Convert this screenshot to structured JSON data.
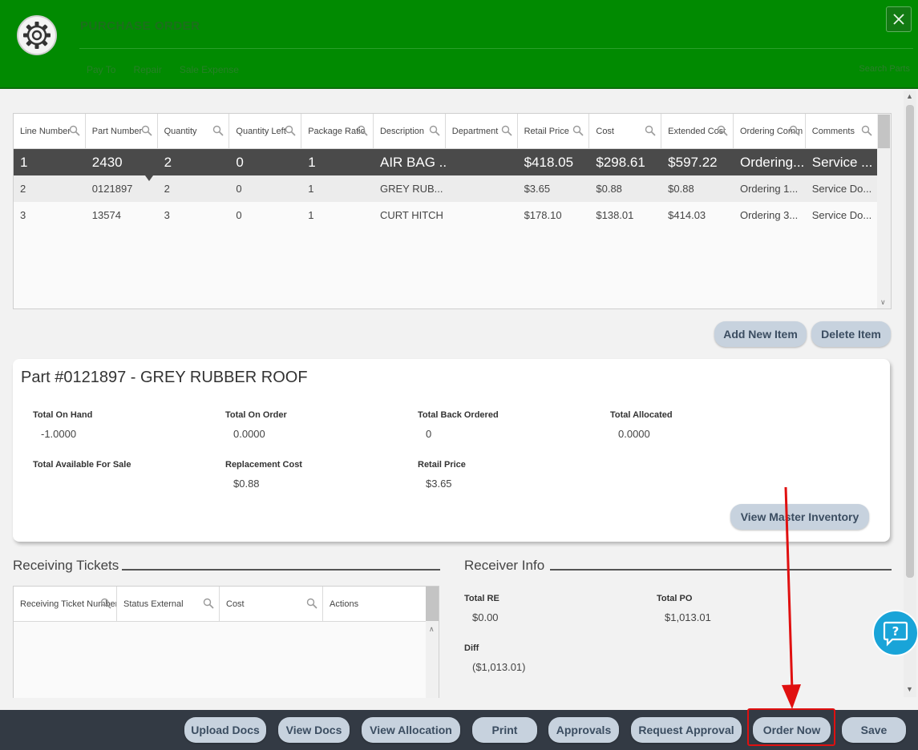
{
  "header": {
    "title": "PURCHASE ORDER",
    "links": [
      "Pay To",
      "Repair",
      "Sale Expense"
    ],
    "right_text": "Search Parts"
  },
  "grid": {
    "columns": [
      "Line Number",
      "Part Number",
      "Quantity",
      "Quantity Left",
      "Package Ratio",
      "Description",
      "Department",
      "Retail Price",
      "Cost",
      "Extended Cost",
      "Ordering Comm",
      "Comments"
    ],
    "rows": [
      [
        "1",
        "2430",
        "2",
        "0",
        "1",
        "AIR BAG ...",
        "",
        "$418.05",
        "$298.61",
        "$597.22",
        "Ordering...",
        "Service ..."
      ],
      [
        "2",
        "0121897",
        "2",
        "0",
        "1",
        "GREY RUB...",
        "",
        "$3.65",
        "$0.88",
        "$0.88",
        "Ordering 1...",
        "Service Do..."
      ],
      [
        "3",
        "13574",
        "3",
        "0",
        "1",
        "CURT HITCH",
        "",
        "$178.10",
        "$138.01",
        "$414.03",
        "Ordering 3...",
        "Service Do..."
      ]
    ],
    "selected_row": 1
  },
  "item_actions": {
    "add": "Add New Item",
    "delete": "Delete Item"
  },
  "part": {
    "title": "Part #0121897 - GREY RUBBER ROOF",
    "total_on_hand_label": "Total On Hand",
    "total_on_hand": "-1.0000",
    "total_on_order_label": "Total On Order",
    "total_on_order": "0.0000",
    "total_back_ordered_label": "Total Back Ordered",
    "total_back_ordered": "0",
    "total_allocated_label": "Total Allocated",
    "total_allocated": "0.0000",
    "total_available_label": "Total Available For Sale",
    "replacement_cost_label": "Replacement Cost",
    "replacement_cost": "$0.88",
    "retail_price_label": "Retail Price",
    "retail_price": "$3.65",
    "view_master_inventory": "View Master Inventory"
  },
  "receiving": {
    "title": "Receiving Tickets",
    "columns": [
      "Receiving Ticket Number",
      "Status External",
      "Cost",
      "Actions"
    ]
  },
  "receiver": {
    "title": "Receiver Info",
    "total_re_label": "Total RE",
    "total_re": "$0.00",
    "total_po_label": "Total PO",
    "total_po": "$1,013.01",
    "diff_label": "Diff",
    "diff": "($1,013.01)"
  },
  "footer": {
    "upload_docs": "Upload Docs",
    "view_docs": "View Docs",
    "view_allocation": "View Allocation",
    "print": "Print",
    "approvals": "Approvals",
    "request_approval": "Request Approval",
    "order_now": "Order Now",
    "save": "Save"
  },
  "colors": {
    "header_bg": "#018a01",
    "selected_row_bg": "#4a4a4a",
    "pill_bg": "#c7d2de",
    "footer_bg": "#333a44",
    "annotation": "#e01010",
    "help_bg": "#19a4d8"
  },
  "icons": {
    "logo": "gear-icon",
    "close": "close-icon",
    "column_search": "magnifier-icon",
    "help": "chat-question-icon"
  }
}
